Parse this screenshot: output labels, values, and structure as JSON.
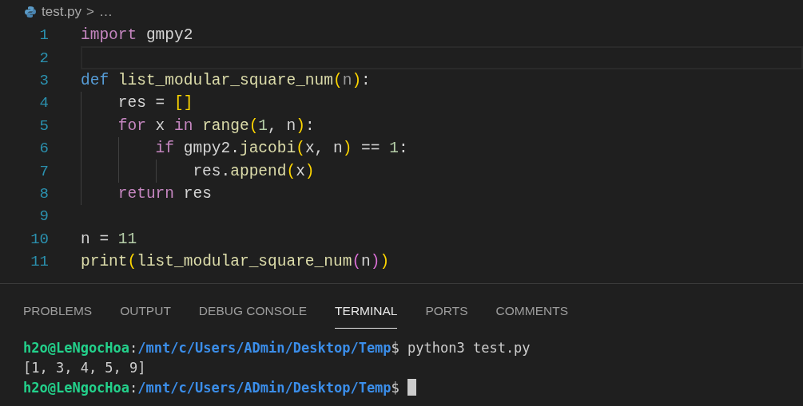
{
  "breadcrumb": {
    "file": "test.py",
    "separator": ">",
    "rest": "…"
  },
  "editor": {
    "lines": [
      {
        "number": "1",
        "current": false,
        "tokens": [
          {
            "kind": "keyword",
            "text": "import"
          },
          {
            "kind": "plain",
            "text": " gmpy2"
          }
        ]
      },
      {
        "number": "2",
        "current": true
      },
      {
        "number": "3",
        "current": false,
        "tokens": [
          {
            "kind": "storage",
            "text": "def "
          },
          {
            "kind": "function",
            "text": "list_modular_square_num"
          },
          {
            "kind": "bracket1",
            "text": "("
          },
          {
            "kind": "param",
            "text": "n"
          },
          {
            "kind": "bracket1",
            "text": ")"
          },
          {
            "kind": "plain",
            "text": ":"
          }
        ]
      },
      {
        "number": "4",
        "current": false,
        "tokens": [
          {
            "kind": "plain",
            "text": "    res = "
          },
          {
            "kind": "bracket1",
            "text": "[]"
          }
        ]
      },
      {
        "number": "5",
        "current": false,
        "tokens": [
          {
            "kind": "keyword",
            "text": "    for"
          },
          {
            "kind": "plain",
            "text": " x "
          },
          {
            "kind": "keyword",
            "text": "in"
          },
          {
            "kind": "function",
            "text": " range"
          },
          {
            "kind": "bracket1",
            "text": "("
          },
          {
            "kind": "number",
            "text": "1"
          },
          {
            "kind": "plain",
            "text": ", n"
          },
          {
            "kind": "bracket1",
            "text": ")"
          },
          {
            "kind": "plain",
            "text": ":"
          }
        ]
      },
      {
        "number": "6",
        "current": false,
        "tokens": [
          {
            "kind": "keyword",
            "text": "        if"
          },
          {
            "kind": "plain",
            "text": " gmpy2."
          },
          {
            "kind": "function",
            "text": "jacobi"
          },
          {
            "kind": "bracket1",
            "text": "("
          },
          {
            "kind": "plain",
            "text": "x, n"
          },
          {
            "kind": "bracket1",
            "text": ")"
          },
          {
            "kind": "plain",
            "text": " == "
          },
          {
            "kind": "number",
            "text": "1"
          },
          {
            "kind": "plain",
            "text": ":"
          }
        ]
      },
      {
        "number": "7",
        "current": false,
        "tokens": [
          {
            "kind": "plain",
            "text": "            res."
          },
          {
            "kind": "function",
            "text": "append"
          },
          {
            "kind": "bracket1",
            "text": "("
          },
          {
            "kind": "plain",
            "text": "x"
          },
          {
            "kind": "bracket1",
            "text": ")"
          }
        ]
      },
      {
        "number": "8",
        "current": false,
        "tokens": [
          {
            "kind": "keyword",
            "text": "    return"
          },
          {
            "kind": "plain",
            "text": " res"
          }
        ]
      },
      {
        "number": "9",
        "current": false
      },
      {
        "number": "10",
        "current": false,
        "tokens": [
          {
            "kind": "plain",
            "text": "n = "
          },
          {
            "kind": "number",
            "text": "11"
          }
        ]
      },
      {
        "number": "11",
        "current": false,
        "tokens": [
          {
            "kind": "function",
            "text": "print"
          },
          {
            "kind": "bracket1",
            "text": "("
          },
          {
            "kind": "function",
            "text": "list_modular_square_num"
          },
          {
            "kind": "bracket2",
            "text": "("
          },
          {
            "kind": "plain",
            "text": "n"
          },
          {
            "kind": "bracket2",
            "text": ")"
          },
          {
            "kind": "bracket1",
            "text": ")"
          }
        ]
      }
    ]
  },
  "panel": {
    "tabs": [
      {
        "label": "PROBLEMS",
        "selected": false
      },
      {
        "label": "OUTPUT",
        "selected": false
      },
      {
        "label": "DEBUG CONSOLE",
        "selected": false
      },
      {
        "label": "TERMINAL",
        "selected": true
      },
      {
        "label": "PORTS",
        "selected": false
      },
      {
        "label": "COMMENTS",
        "selected": false
      }
    ],
    "terminal": [
      {
        "segments": [
          {
            "kind": "user",
            "text": "h2o@LeNgocHoa"
          },
          {
            "kind": "plain",
            "text": ":"
          },
          {
            "kind": "path",
            "text": "/mnt/c/Users/ADmin/Desktop/Temp"
          },
          {
            "kind": "plain",
            "text": "$ python3 test.py"
          }
        ],
        "cursor": false
      },
      {
        "segments": [
          {
            "kind": "plain",
            "text": "[1, 3, 4, 5, 9]"
          }
        ],
        "cursor": false
      },
      {
        "segments": [
          {
            "kind": "user",
            "text": "h2o@LeNgocHoa"
          },
          {
            "kind": "plain",
            "text": ":"
          },
          {
            "kind": "path",
            "text": "/mnt/c/Users/ADmin/Desktop/Temp"
          },
          {
            "kind": "plain",
            "text": "$ "
          }
        ],
        "cursor": true
      }
    ]
  }
}
